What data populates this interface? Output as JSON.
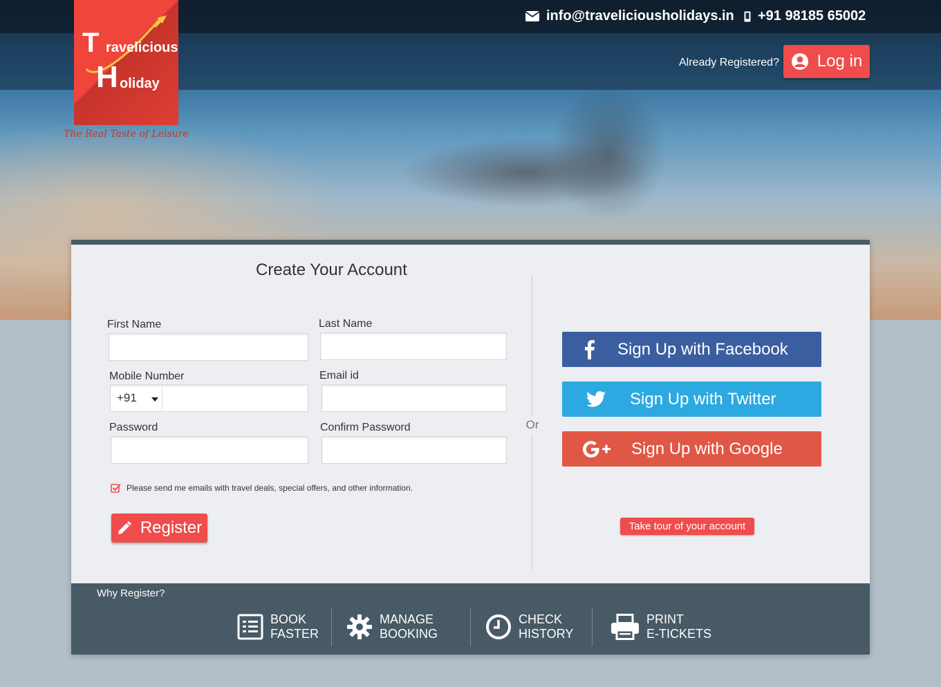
{
  "header": {
    "email": "info@traveliciousholidays.in",
    "phone": "+91 98185 65002",
    "already_registered": "Already Registered?",
    "login_label": "Log in"
  },
  "logo": {
    "text_line1": "ravelicious",
    "text_line2": "oliday",
    "initial1": "T",
    "initial2": "H",
    "tagline": "The Real Taste of Leisure"
  },
  "form": {
    "title": "Create Your Account",
    "first_name": {
      "label": "First Name",
      "value": "",
      "placeholder": ""
    },
    "last_name": {
      "label": "Last Name",
      "value": "",
      "placeholder": ""
    },
    "mobile": {
      "label": "Mobile Number",
      "country_code": "+91",
      "value": ""
    },
    "email": {
      "label": "Email id",
      "value": ""
    },
    "password": {
      "label": "Password",
      "value": ""
    },
    "confirm_password": {
      "label": "Confirm Password",
      "value": ""
    },
    "consent": {
      "checked": true,
      "text": "Please send me emails with travel deals, special offers, and other information."
    },
    "register_label": "Register"
  },
  "divider_text": "Or",
  "social": {
    "facebook": "Sign Up with Facebook",
    "twitter": "Sign Up with Twitter",
    "google": "Sign Up with Google"
  },
  "tour_label": "Take tour of your account",
  "why_register": {
    "title": "Why Register?",
    "features": [
      {
        "line1": "BOOK",
        "line2": "FASTER",
        "icon": "checklist-icon"
      },
      {
        "line1": "MANAGE",
        "line2": "BOOKING",
        "icon": "gear-icon"
      },
      {
        "line1": "CHECK",
        "line2": "HISTORY",
        "icon": "clock-icon"
      },
      {
        "line1": "PRINT",
        "line2": "E-TICKETS",
        "icon": "printer-icon"
      }
    ]
  },
  "colors": {
    "accent": "#f04c4c",
    "facebook": "#3b5ea1",
    "twitter": "#2ca9e1",
    "google": "#e05745",
    "footer_band": "#485a66",
    "logo_bg": "#f0453a"
  }
}
